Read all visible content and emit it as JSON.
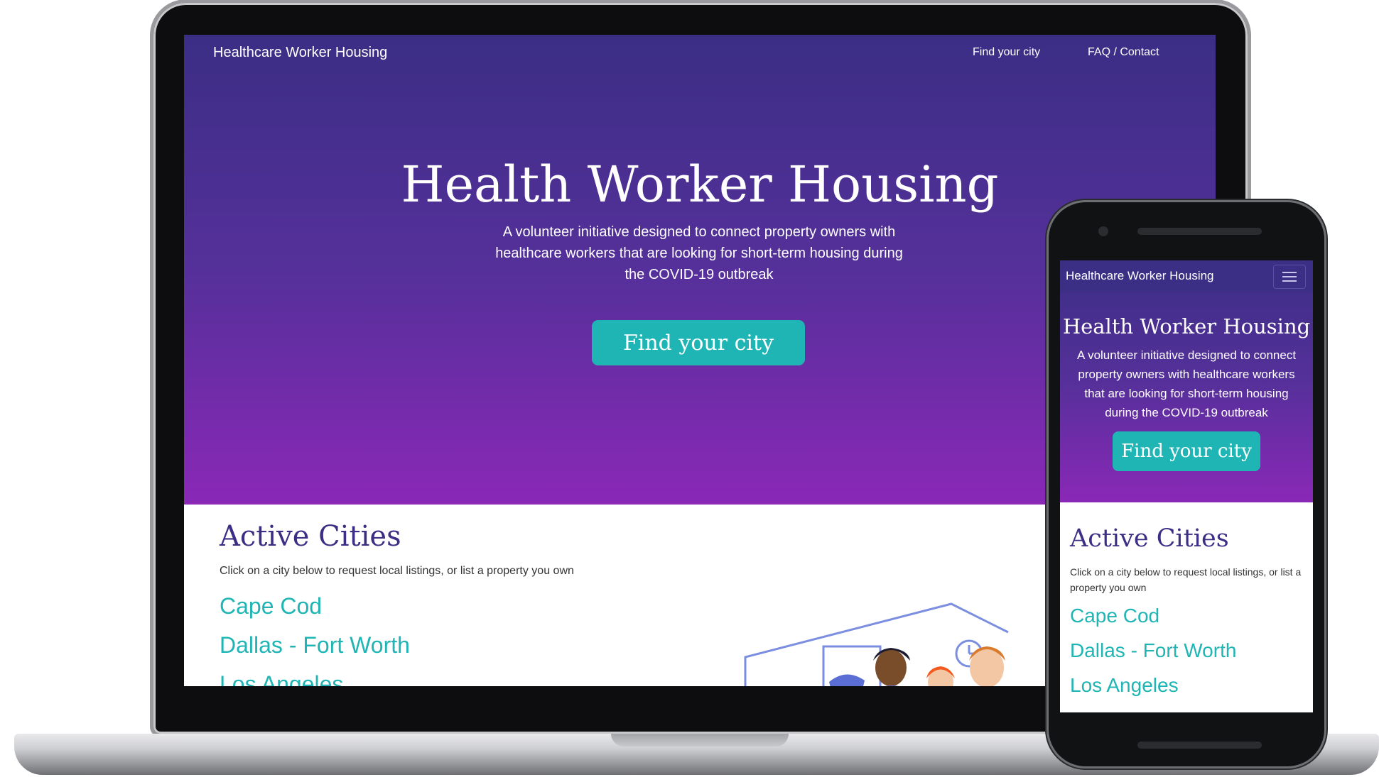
{
  "desktop": {
    "navbar": {
      "brand": "Healthcare Worker Housing",
      "links": [
        "Find your city",
        "FAQ / Contact"
      ]
    },
    "hero": {
      "title": "Health Worker Housing",
      "subtitle": "A volunteer initiative designed to connect property owners with healthcare workers that are looking for short-term housing during the COVID-19 outbreak",
      "cta": "Find your city"
    },
    "cities": {
      "title": "Active Cities",
      "description": "Click on a city below to request local listings, or list a property you own",
      "items": [
        "Cape Cod",
        "Dallas - Fort Worth",
        "Los Angeles"
      ]
    }
  },
  "mobile": {
    "navbar": {
      "brand": "Healthcare Worker Housing",
      "menu_icon": "hamburger-menu-icon"
    },
    "hero": {
      "title": "Health Worker Housing",
      "subtitle": "A volunteer initiative designed to connect property owners with healthcare workers that are looking for short-term housing during the COVID-19 outbreak",
      "cta": "Find your city"
    },
    "cities": {
      "title": "Active Cities",
      "description": "Click on a city below to request local listings, or list a property you own",
      "items": [
        "Cape Cod",
        "Dallas - Fort Worth",
        "Los Angeles"
      ]
    }
  },
  "colors": {
    "hero_top": "#3b2e85",
    "hero_bottom": "#8a28b7",
    "accent_teal": "#1fb5b4",
    "heading_purple": "#3b2e85"
  },
  "illustration": {
    "icon": "healthcare-workers-illustration"
  }
}
